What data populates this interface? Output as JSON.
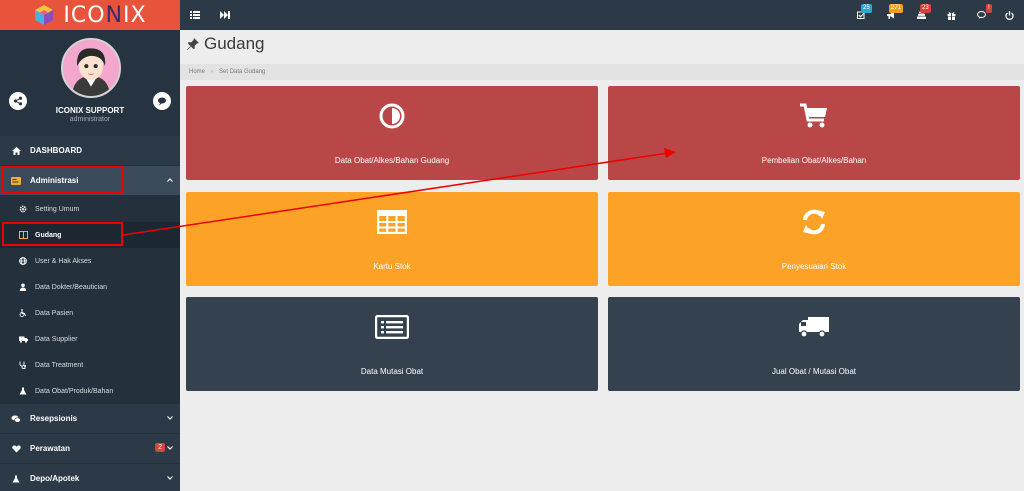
{
  "brand": {
    "name_prefix": "ICO",
    "name_x": "N",
    "name_suffix": "IX"
  },
  "profile": {
    "name": "ICONIX SUPPORT",
    "role": "administrator"
  },
  "menu": {
    "dashboard": "DASHBOARD",
    "administrasi": "Administrasi",
    "sub": [
      {
        "label": "Setting Umum",
        "icon": "gear-icon"
      },
      {
        "label": "Gudang",
        "icon": "book-icon"
      },
      {
        "label": "User & Hak Akses",
        "icon": "globe-icon"
      },
      {
        "label": "Data Dokter/Beautician",
        "icon": "user-icon"
      },
      {
        "label": "Data Pasien",
        "icon": "wheelchair-icon"
      },
      {
        "label": "Data Supplier",
        "icon": "truck-icon"
      },
      {
        "label": "Data Treatment",
        "icon": "stethoscope-icon"
      },
      {
        "label": "Data Obat/Produk/Bahan",
        "icon": "flask-icon"
      }
    ],
    "resepsionis": "Resepsionis",
    "perawatan": "Perawatan",
    "perawatan_badge": "2",
    "depo": "Depo/Apotek"
  },
  "topbar": {
    "badges": {
      "tasks": "25",
      "notifications": "271",
      "messages": "23",
      "alerts": "!"
    }
  },
  "page": {
    "title": "Gudang"
  },
  "breadcrumb": {
    "home": "Home",
    "current": "Set Data Gudang"
  },
  "tiles": [
    {
      "label": "Data Obat/Alkes/Bahan Gudang",
      "icon": "half-circle-icon"
    },
    {
      "label": "Pembelian Obat/Alkes/Bahan",
      "icon": "cart-icon"
    },
    {
      "label": "Kartu Stok",
      "icon": "table-icon"
    },
    {
      "label": "Penyesuaian Stok",
      "icon": "refresh-icon"
    },
    {
      "label": "Data Mutasi Obat",
      "icon": "list-icon"
    },
    {
      "label": "Jual Obat / Mutasi Obat",
      "icon": "truck-icon"
    }
  ],
  "colors": {
    "brand": "#e8533c",
    "sidebar": "#2c3a47",
    "tile_red": "#b94747",
    "tile_orange": "#fca226",
    "tile_dark": "#344250",
    "annotation": "#ee0000"
  }
}
